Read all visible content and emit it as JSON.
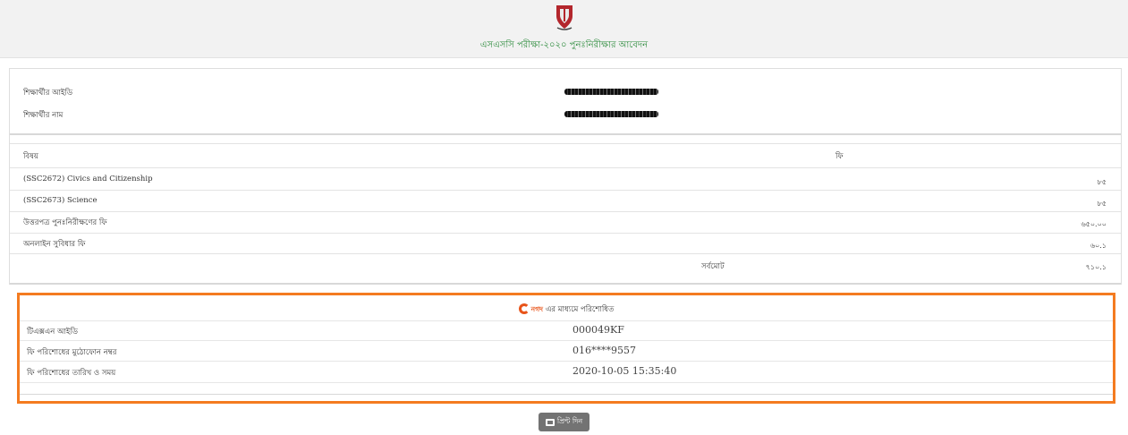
{
  "header": {
    "title": "এসএসসি পরীক্ষা-২০২০ পুনঃনিরীক্ষার আবেদন",
    "logo_icon": "board-crest-icon"
  },
  "student": {
    "id_label": "শিক্ষার্থীর আইডি",
    "name_label": "শিক্ষার্থীর নাম"
  },
  "fees_table": {
    "headers": {
      "subject": "বিষয়",
      "fee": "ফি"
    },
    "rows": [
      {
        "subject": "(SSC2672) Civics and Citizenship",
        "fee": "৮৫"
      },
      {
        "subject": "(SSC2673) Science",
        "fee": "৮৫"
      },
      {
        "subject": "উত্তরপত্র পুনঃনিরীক্ষণের ফি",
        "fee": "৬৫০.০০"
      },
      {
        "subject": "অনলাইন সুবিধার ফি",
        "fee": "৬০.১"
      }
    ],
    "total_label": "সর্বমোট",
    "total_value": "৭১০.১"
  },
  "payment": {
    "provider": "নগদ",
    "provider_suffix": "এর মাধ্যমে পরিশোধিত",
    "accent_color": "#f47b20",
    "rows": [
      {
        "label": "টিএক্সএন আইডি",
        "value": "000049KF"
      },
      {
        "label": "ফি পরিশোধের মুঠোফোন নম্বর",
        "value": "016****9557"
      },
      {
        "label": "ফি পরিশোধের তারিখ ও সময়",
        "value": "2020-10-05 15:35:40"
      }
    ]
  },
  "print_button": {
    "label": "প্রিন্ট দিন",
    "icon": "printer-icon"
  }
}
